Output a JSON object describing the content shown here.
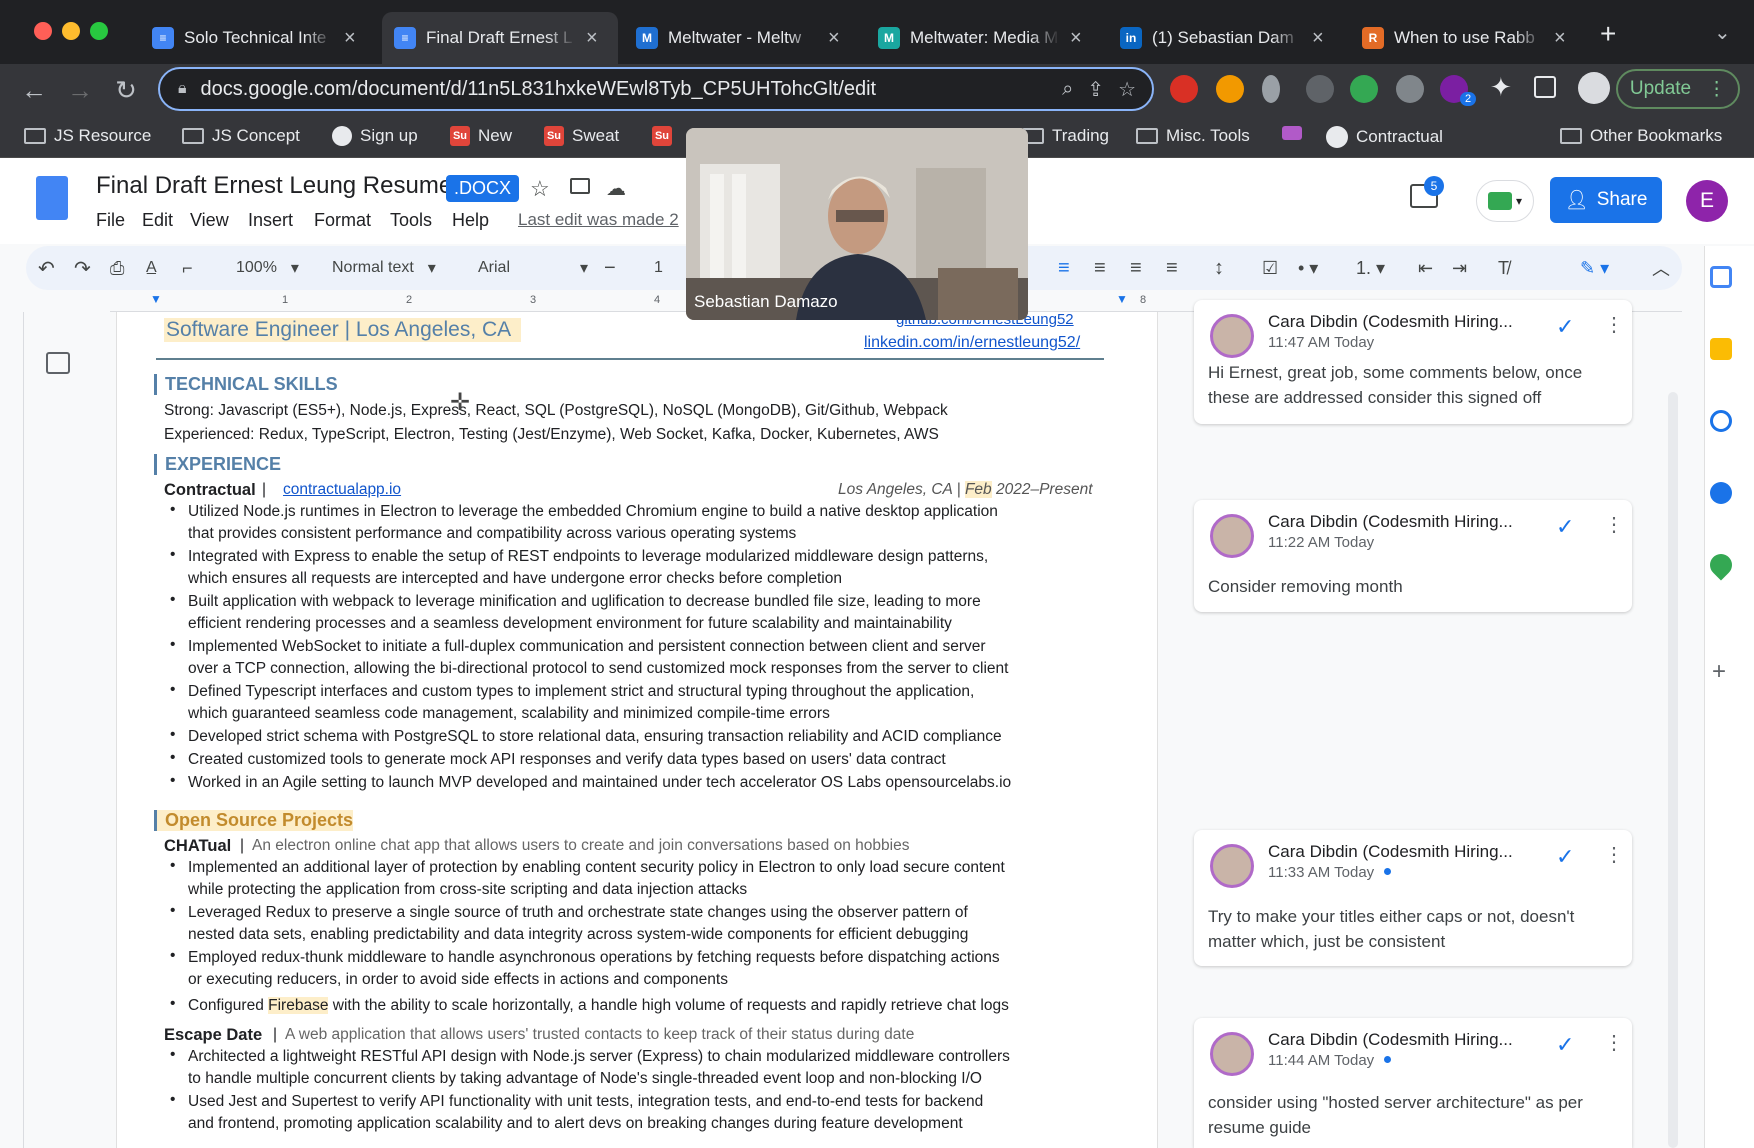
{
  "tabs": [
    {
      "icon": "docs-icon",
      "title": "Solo Technical Inte",
      "active": false
    },
    {
      "icon": "docs-icon",
      "title": "Final Draft Ernest L",
      "active": true
    },
    {
      "icon": "meltwater-icon",
      "title": "Meltwater - Meltw",
      "active": false
    },
    {
      "icon": "meltwater-icon",
      "title": "Meltwater: Media M",
      "active": false
    },
    {
      "icon": "linkedin-icon",
      "title": "(1) Sebastian Dam",
      "active": false
    },
    {
      "icon": "rabbit-icon",
      "title": "When to use Rabb",
      "active": false
    }
  ],
  "browser": {
    "url": "docs.google.com/document/d/11n5L831hxkeWEwl8Tyb_CP5UHTohcGlt/edit",
    "update_label": "Update",
    "extension_badge": "2"
  },
  "bookmarks": [
    {
      "type": "folder",
      "label": "JS Resource"
    },
    {
      "type": "folder",
      "label": "JS Concept"
    },
    {
      "type": "globe",
      "label": "Sign up"
    },
    {
      "type": "sup",
      "label": "New"
    },
    {
      "type": "sup",
      "label": "Sweat"
    },
    {
      "type": "folder",
      "label": "Trading"
    },
    {
      "type": "folder",
      "label": "Misc. Tools"
    },
    {
      "type": "github",
      "label": "Contractual"
    },
    {
      "type": "folder",
      "label": "Other Bookmarks"
    }
  ],
  "doc": {
    "title": "Final Draft Ernest Leung Resume",
    "badge": ".DOCX",
    "menus": [
      "File",
      "Edit",
      "View",
      "Insert",
      "Format",
      "Tools",
      "Help"
    ],
    "last_edit": "Last edit was made 2",
    "share_label": "Share",
    "avatar_letter": "E",
    "comments_count": "5",
    "zoom": "100%",
    "style": "Normal text",
    "font": "Arial",
    "font_size": "1",
    "ruler_marks": [
      "1",
      "2",
      "3",
      "4",
      "8"
    ]
  },
  "resume": {
    "role_line": "Software Engineer | Los Angeles, CA",
    "link1": "github.com/ernestLeung52",
    "link2": "linkedin.com/in/ernestleung52/",
    "skills_header": "TECHNICAL SKILLS",
    "skills_strong": "Strong: Javascript (ES5+), Node.js, Express, React, SQL (PostgreSQL), NoSQL (MongoDB), Git/Github, Webpack",
    "skills_exp": "Experienced: Redux, TypeScript, Electron, Testing (Jest/Enzyme), Web Socket, Kafka, Docker, Kubernetes, AWS",
    "experience_header": "EXPERIENCE",
    "company": "Contractual",
    "company_link": "contractualapp.io",
    "company_loc_pre": "Los Angeles, CA | ",
    "company_month": "Feb",
    "company_loc_post": " 2022–Present",
    "exp_bullets": [
      [
        "Utilized Node.js runtimes in Electron to leverage the embedded Chromium engine to build a native desktop application",
        "that provides consistent performance and compatibility across various operating systems"
      ],
      [
        "Integrated with Express to enable the setup of REST endpoints to leverage modularized middleware design patterns,",
        "which ensures all requests are intercepted and have undergone error checks before completion"
      ],
      [
        "Built application with webpack to leverage minification and uglification to decrease bundled file size, leading to more",
        "efficient rendering processes and a seamless development environment for future scalability and maintainability"
      ],
      [
        "Implemented WebSocket to initiate a full-duplex communication and persistent connection between client and server",
        "over a TCP connection, allowing the bi-directional protocol to send customized mock responses from the server to client"
      ],
      [
        "Defined Typescript interfaces and custom types to implement strict and structural typing throughout the application,",
        "which guaranteed seamless code management, scalability and minimized compile-time errors"
      ],
      [
        "Developed strict schema with PostgreSQL to store relational data, ensuring transaction reliability and ACID compliance"
      ],
      [
        "Created customized tools to generate mock API responses and verify data types based on users' data contract"
      ],
      [
        "Worked in an Agile setting to launch MVP developed and maintained under tech accelerator OS Labs opensourcelabs.io"
      ]
    ],
    "oss_header": "Open Source Projects",
    "proj1_name": "CHATual",
    "proj1_desc": "An electron online chat app that allows users to create and join conversations based on hobbies",
    "proj1_bullets": [
      [
        "Implemented an additional layer of protection by enabling content security policy in Electron to only load secure content",
        "while protecting the application from cross-site scripting and data injection attacks"
      ],
      [
        "Leveraged Redux to preserve a single source of truth and orchestrate state changes using the observer pattern of",
        "nested data sets, enabling predictability and data integrity across system-wide components for efficient debugging"
      ],
      [
        "Employed redux-thunk middleware to handle asynchronous operations by fetching requests before dispatching actions",
        "or executing reducers, in order to avoid side effects in actions and components"
      ]
    ],
    "proj1_last_pre": "Configured ",
    "proj1_last_hl": "Firebase",
    "proj1_last_post": " with the ability to scale horizontally, a handle high volume of requests and rapidly retrieve chat logs",
    "proj2_name": "Escape Date",
    "proj2_desc": "A web application that allows users' trusted contacts to keep track of their status during date",
    "proj2_bullets": [
      [
        "Architected a lightweight RESTful API design with Node.js server (Express) to chain modularized middleware controllers",
        "to handle multiple concurrent clients by taking advantage of Node's single-threaded event loop and non-blocking I/O"
      ],
      [
        "Used Jest and Supertest to verify API functionality with unit tests, integration tests, and end-to-end tests for backend",
        "and frontend,  promoting application scalability and to alert devs on breaking changes during feature development"
      ]
    ]
  },
  "comments": [
    {
      "author": "Cara Dibdin (Codesmith Hiring...",
      "time": "11:47 AM Today",
      "body": "Hi Ernest, great job, some comments below, once these are addressed consider this signed off"
    },
    {
      "author": "Cara Dibdin (Codesmith Hiring...",
      "time": "11:22 AM Today",
      "body": "Consider removing month"
    },
    {
      "author": "Cara Dibdin (Codesmith Hiring...",
      "time": "11:33 AM Today",
      "body": "Try to make your titles either caps or not, doesn't matter which, just be consistent"
    },
    {
      "author": "Cara Dibdin (Codesmith Hiring...",
      "time": "11:44 AM Today",
      "body": "consider using \"hosted server architecture\" as per resume guide"
    }
  ],
  "video": {
    "participant": "Sebastian Damazo"
  }
}
